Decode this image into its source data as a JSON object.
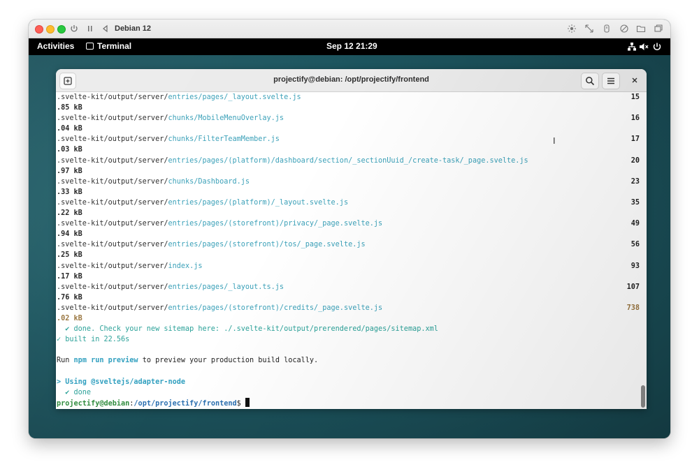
{
  "vm": {
    "title": "Debian 12"
  },
  "topbar": {
    "activities": "Activities",
    "app_name": "Terminal",
    "clock": "Sep 12  21:29"
  },
  "terminal": {
    "title": "projectify@debian: /opt/projectify/frontend",
    "lines": [
      {
        "prefix": ".svelte-kit/output/server/",
        "suffix": "entries/pages/_layout.svelte.js",
        "size": "15"
      },
      {
        "kb": ".85 kB"
      },
      {
        "prefix": ".svelte-kit/output/server/",
        "suffix": "chunks/MobileMenuOverlay.js",
        "size": "16"
      },
      {
        "kb": ".04 kB"
      },
      {
        "prefix": ".svelte-kit/output/server/",
        "suffix": "chunks/FilterTeamMember.js",
        "size": "17"
      },
      {
        "kb": ".03 kB"
      },
      {
        "prefix": ".svelte-kit/output/server/",
        "suffix": "entries/pages/(platform)/dashboard/section/_sectionUuid_/create-task/_page.svelte.js",
        "size": "20"
      },
      {
        "kb": ".97 kB"
      },
      {
        "prefix": ".svelte-kit/output/server/",
        "suffix": "chunks/Dashboard.js",
        "size": "23"
      },
      {
        "kb": ".33 kB"
      },
      {
        "prefix": ".svelte-kit/output/server/",
        "suffix": "entries/pages/(platform)/_layout.svelte.js",
        "size": "35"
      },
      {
        "kb": ".22 kB"
      },
      {
        "prefix": ".svelte-kit/output/server/",
        "suffix": "entries/pages/(storefront)/privacy/_page.svelte.js",
        "size": "49"
      },
      {
        "kb": ".94 kB"
      },
      {
        "prefix": ".svelte-kit/output/server/",
        "suffix": "entries/pages/(storefront)/tos/_page.svelte.js",
        "size": "56"
      },
      {
        "kb": ".25 kB"
      },
      {
        "prefix": ".svelte-kit/output/server/",
        "suffix": "index.js",
        "size": "93"
      },
      {
        "kb": ".17 kB"
      },
      {
        "prefix": ".svelte-kit/output/server/",
        "suffix": "entries/pages/_layout.ts.js",
        "size": "107"
      },
      {
        "kb": ".76 kB"
      },
      {
        "prefix": ".svelte-kit/output/server/",
        "suffix": "entries/pages/(storefront)/credits/_page.svelte.js",
        "size": "738",
        "warn": true
      },
      {
        "kb": ".02 kB",
        "warn": true
      }
    ],
    "done_sitemap": "  ✔ done. Check your new sitemap here: ./.svelte-kit/output/prerendered/pages/sitemap.xml",
    "built": "✓ built in 22.56s",
    "run_pre": "Run ",
    "run_cmd": "npm run preview",
    "run_post": " to preview your production build locally.",
    "adapter": "> Using @sveltejs/adapter-node",
    "adapter_done": "  ✔ done",
    "prompt_user": "projectify@debian",
    "prompt_sep": ":",
    "prompt_path": "/opt/projectify/frontend",
    "prompt_end": "$ "
  },
  "icons": {
    "vm_power": "power-icon",
    "vm_pause": "pause-icon",
    "vm_back": "back-icon",
    "network": "network-icon",
    "sound": "volume-muted-icon",
    "power": "power-menu-icon"
  }
}
